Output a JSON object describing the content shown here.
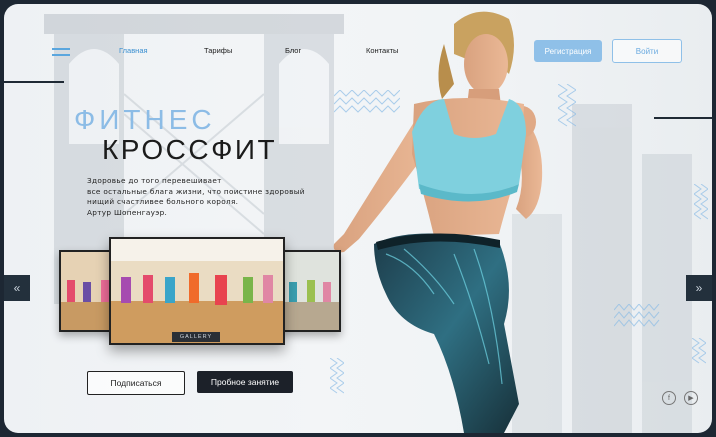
{
  "nav": {
    "items": [
      {
        "label": "Главная",
        "active": true
      },
      {
        "label": "Тарифы",
        "active": false
      },
      {
        "label": "Блог",
        "active": false
      },
      {
        "label": "Контакты",
        "active": false
      }
    ]
  },
  "header": {
    "register_label": "Регистрация",
    "login_label": "Войти"
  },
  "hero": {
    "title_line1": "ФИТНЕС",
    "title_line2": "КРОССФИТ",
    "quote_lines": [
      "Здоровье до того перевешивает",
      "все остальные блага жизни, что поистине здоровый",
      "нищий счастливее больного короля.",
      "Артур Шопенгауэр."
    ]
  },
  "gallery": {
    "label": "GALLERY"
  },
  "arrows": {
    "prev": "«",
    "next": "»"
  },
  "actions": {
    "subscribe_label": "Подписаться",
    "trial_label": "Пробное занятие"
  },
  "social": [
    {
      "icon": "facebook-icon",
      "glyph": "f"
    },
    {
      "icon": "youtube-icon",
      "glyph": "▶"
    }
  ],
  "colors": {
    "accent": "#8fc0e8",
    "accent_text": "#3a8fd0",
    "dark": "#1c2129",
    "frame": "#1d2733"
  }
}
